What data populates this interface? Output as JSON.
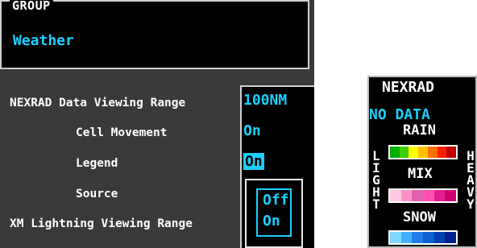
{
  "group": {
    "label": "GROUP",
    "value": "Weather"
  },
  "settings": [
    {
      "label": "NEXRAD Data Viewing Range",
      "value": "100NM"
    },
    {
      "label": "Cell Movement",
      "value": "On"
    },
    {
      "label": "Legend",
      "value": "On"
    },
    {
      "label": "Source",
      "value": ""
    },
    {
      "label": "XM Lightning Viewing Range",
      "value": ""
    }
  ],
  "popup": {
    "options": [
      "Off",
      "On"
    ]
  },
  "legend": {
    "title": "NEXRAD",
    "no_data": "NO DATA",
    "left_label": "LIGHT",
    "right_label": "HEAVY",
    "categories": [
      {
        "name": "RAIN",
        "colors": [
          "#00b000",
          "#3cd000",
          "#ffff00",
          "#ffc000",
          "#ff7000",
          "#ff2000",
          "#c00000"
        ]
      },
      {
        "name": "MIX",
        "colors": [
          "#ffc8e0",
          "#ff90c8",
          "#e060b0",
          "#ff50b0",
          "#e02090",
          "#d00070"
        ]
      },
      {
        "name": "SNOW",
        "colors": [
          "#80d8ff",
          "#40b0ff",
          "#2080e8",
          "#1060d0",
          "#0040b0",
          "#002090"
        ]
      }
    ]
  }
}
